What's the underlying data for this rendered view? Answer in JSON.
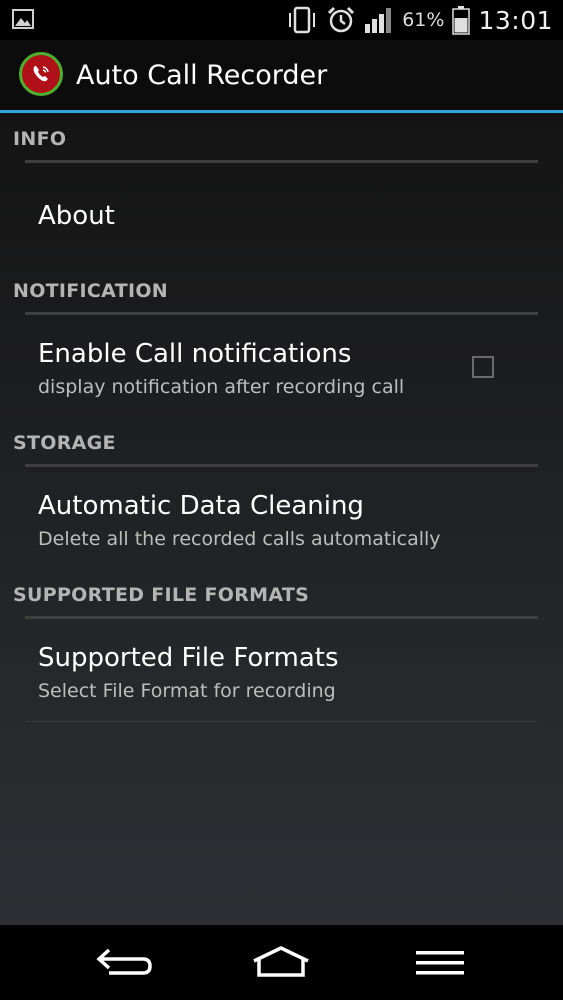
{
  "status_bar": {
    "battery_percent": "61%",
    "time": "13:01",
    "icons": [
      "gallery-icon",
      "vibrate-icon",
      "alarm-icon",
      "signal-icon",
      "battery-icon"
    ]
  },
  "action_bar": {
    "title": "Auto Call Recorder",
    "icon": "phone-recorder-app-icon",
    "accent_color": "#2fa6d9"
  },
  "sections": [
    {
      "header": "INFO",
      "items": [
        {
          "title": "About"
        }
      ]
    },
    {
      "header": "NOTIFICATION",
      "items": [
        {
          "title": "Enable Call notifications",
          "summary": "display notification after recording call",
          "checked": false
        }
      ]
    },
    {
      "header": "STORAGE",
      "items": [
        {
          "title": "Automatic Data Cleaning",
          "summary": "Delete all the recorded calls automatically"
        }
      ]
    },
    {
      "header": "SUPPORTED FILE FORMATS",
      "items": [
        {
          "title": "Supported File Formats",
          "summary": "Select File Format for recording"
        }
      ]
    }
  ],
  "nav_bar": {
    "buttons": [
      "back-icon",
      "home-icon",
      "menu-icon"
    ]
  }
}
